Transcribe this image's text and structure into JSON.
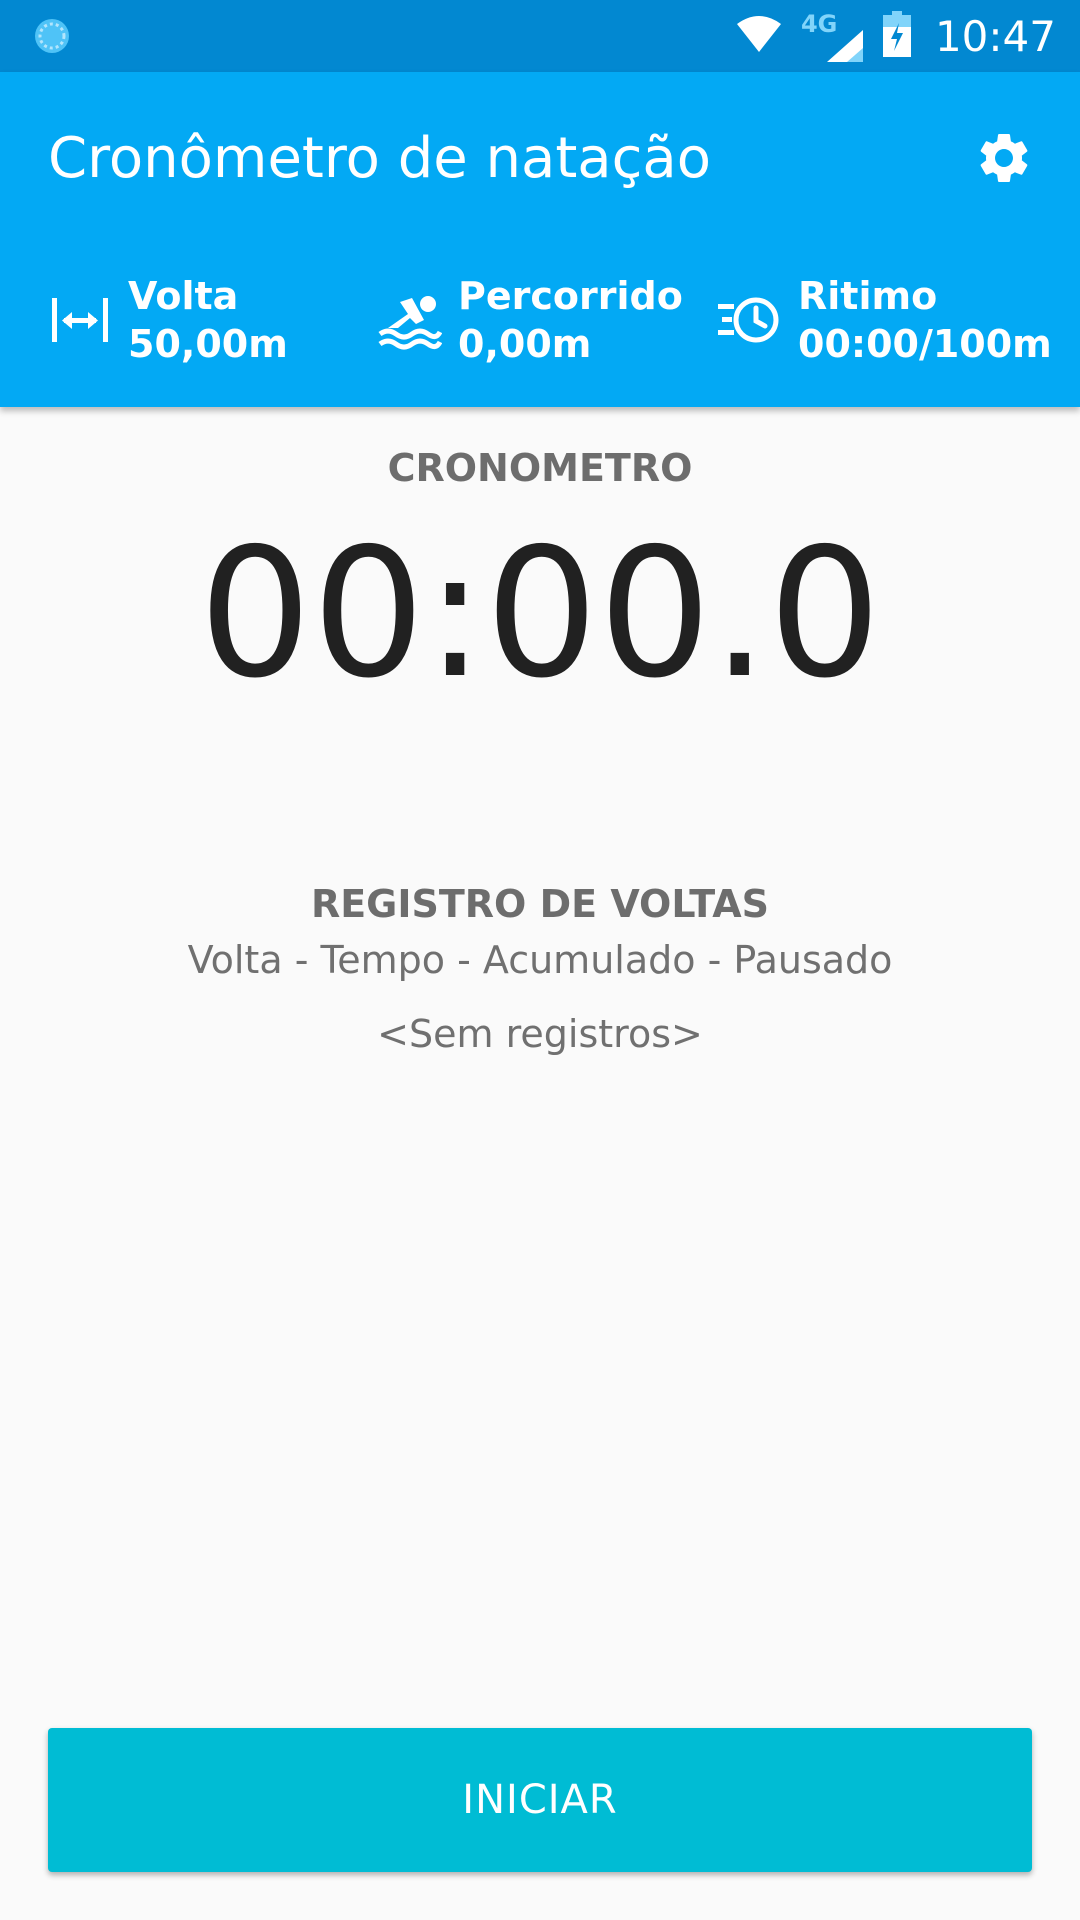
{
  "status_bar": {
    "time": "10:47",
    "network_type": "4G",
    "icons": [
      "sync-icon",
      "wifi-icon",
      "signal-icon",
      "battery-charging-icon"
    ]
  },
  "app_bar": {
    "title": "Cronômetro de natação",
    "settings_icon": "gear-icon"
  },
  "stats": {
    "lap": {
      "icon": "lap-length-icon",
      "label": "Volta",
      "value": "50,00m"
    },
    "distance": {
      "icon": "swimmer-icon",
      "label": "Percorrido",
      "value": "0,00m"
    },
    "pace": {
      "icon": "pace-timer-icon",
      "label": "Ritimo",
      "value": "00:00/100m"
    }
  },
  "stopwatch": {
    "label": "CRONOMETRO",
    "time": "00:00.0"
  },
  "laps": {
    "title": "REGISTRO DE VOLTAS",
    "columns": "Volta - Tempo - Acumulado - Pausado",
    "empty_text": "<Sem registros>"
  },
  "actions": {
    "start_label": "INICIAR"
  },
  "colors": {
    "status_bar": "#0288d1",
    "app_bar": "#03a9f4",
    "button": "#00bcd4",
    "background": "#fafafa"
  }
}
